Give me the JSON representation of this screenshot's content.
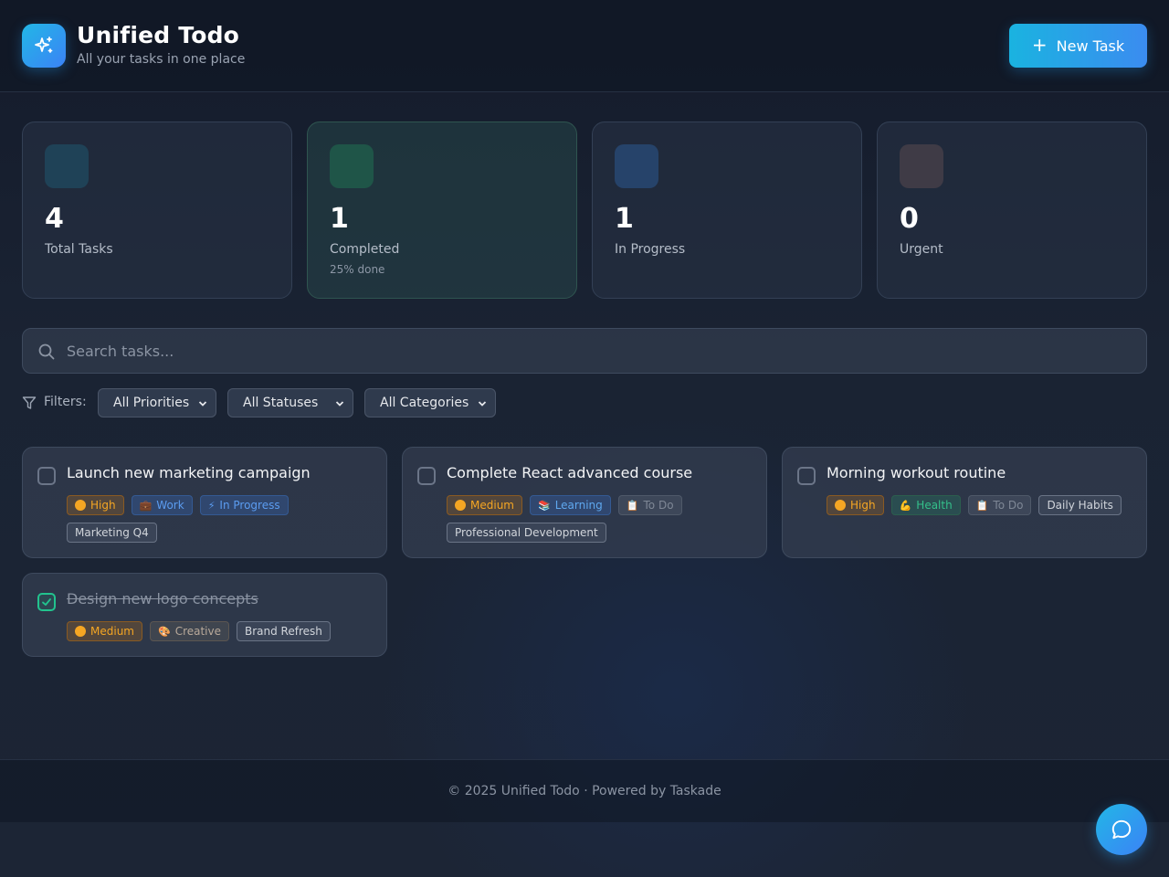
{
  "app": {
    "title": "Unified Todo",
    "subtitle": "All your tasks in one place",
    "logo_icon": "sparkles-icon",
    "new_task_label": "New Task",
    "accent": "#22b7e6"
  },
  "stats": [
    {
      "value": "4",
      "label": "Total Tasks",
      "sub": "",
      "icon_color": "#1f4257"
    },
    {
      "value": "1",
      "label": "Completed",
      "sub": "25% done",
      "icon_color": "#1f5548"
    },
    {
      "value": "1",
      "label": "In Progress",
      "sub": "",
      "icon_color": "#26436a"
    },
    {
      "value": "0",
      "label": "Urgent",
      "sub": "",
      "icon_color": "#3f3b46"
    }
  ],
  "search": {
    "placeholder": "Search tasks...",
    "value": ""
  },
  "filters": {
    "label": "Filters:",
    "priority": "All Priorities",
    "status": "All Statuses",
    "category": "All Categories"
  },
  "tasks": [
    {
      "title": "Launch new marketing campaign",
      "completed": false,
      "priority": "High",
      "category": "Work",
      "category_icon": "💼",
      "status": "In Progress",
      "status_icon": "⚡",
      "project": "Marketing Q4"
    },
    {
      "title": "Complete React advanced course",
      "completed": false,
      "priority": "Medium",
      "category": "Learning",
      "category_icon": "📚",
      "status": "To Do",
      "status_icon": "📋",
      "project": "Professional Development"
    },
    {
      "title": "Morning workout routine",
      "completed": false,
      "priority": "High",
      "category": "Health",
      "category_icon": "💪",
      "status": "To Do",
      "status_icon": "📋",
      "project": "Daily Habits"
    },
    {
      "title": "Design new logo concepts",
      "completed": true,
      "priority": "Medium",
      "category": "Creative",
      "category_icon": "🎨",
      "project": "Brand Refresh"
    }
  ],
  "footer": {
    "text": "© 2025 Unified Todo · Powered by Taskade"
  },
  "chat": {
    "icon": "chat-bubble-icon"
  }
}
